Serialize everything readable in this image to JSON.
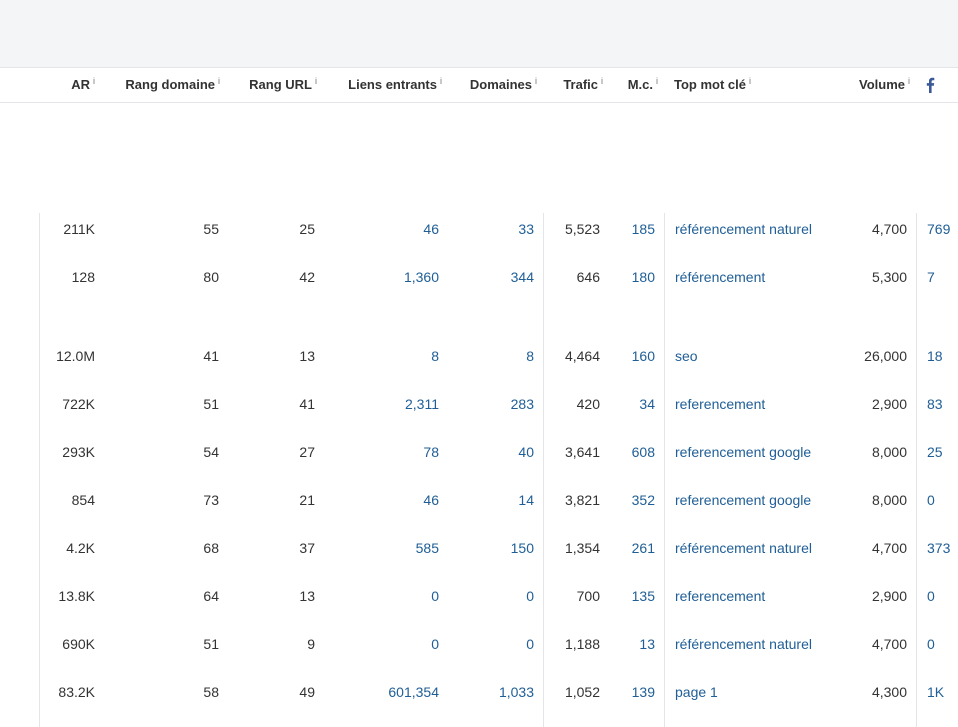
{
  "colors": {
    "text": "#333333",
    "link": "#1f5e96",
    "border": "#e3e5e8",
    "topbar": "#f4f5f7"
  },
  "info_glyph": "i",
  "header": {
    "ar": "AR",
    "rang_domaine": "Rang domaine",
    "rang_url": "Rang URL",
    "liens_entrants": "Liens entrants",
    "domaines": "Domaines",
    "trafic": "Trafic",
    "mc": "M.c.",
    "top_mot_cle": "Top mot clé",
    "volume": "Volume",
    "facebook_icon": "facebook-icon"
  },
  "rows": [
    {
      "ar": "211K",
      "rd": "55",
      "ru": "25",
      "le": "46",
      "dom": "33",
      "tr": "5,523",
      "mc": "185",
      "kw": "référencement naturel",
      "vol": "4,700",
      "fb": "769"
    },
    {
      "ar": "128",
      "rd": "80",
      "ru": "42",
      "le": "1,360",
      "dom": "344",
      "tr": "646",
      "mc": "180",
      "kw": "référencement",
      "vol": "5,300",
      "fb": "7"
    },
    {
      "ar": "12.0M",
      "rd": "41",
      "ru": "13",
      "le": "8",
      "dom": "8",
      "tr": "4,464",
      "mc": "160",
      "kw": "seo",
      "vol": "26,000",
      "fb": "18"
    },
    {
      "ar": "722K",
      "rd": "51",
      "ru": "41",
      "le": "2,311",
      "dom": "283",
      "tr": "420",
      "mc": "34",
      "kw": "referencement",
      "vol": "2,900",
      "fb": "83"
    },
    {
      "ar": "293K",
      "rd": "54",
      "ru": "27",
      "le": "78",
      "dom": "40",
      "tr": "3,641",
      "mc": "608",
      "kw": "referencement google",
      "vol": "8,000",
      "fb": "25"
    },
    {
      "ar": "854",
      "rd": "73",
      "ru": "21",
      "le": "46",
      "dom": "14",
      "tr": "3,821",
      "mc": "352",
      "kw": "referencement google",
      "vol": "8,000",
      "fb": "0"
    },
    {
      "ar": "4.2K",
      "rd": "68",
      "ru": "37",
      "le": "585",
      "dom": "150",
      "tr": "1,354",
      "mc": "261",
      "kw": "référencement naturel",
      "vol": "4,700",
      "fb": "373"
    },
    {
      "ar": "13.8K",
      "rd": "64",
      "ru": "13",
      "le": "0",
      "dom": "0",
      "tr": "700",
      "mc": "135",
      "kw": "referencement",
      "vol": "2,900",
      "fb": "0"
    },
    {
      "ar": "690K",
      "rd": "51",
      "ru": "9",
      "le": "0",
      "dom": "0",
      "tr": "1,188",
      "mc": "13",
      "kw": "référencement naturel",
      "vol": "4,700",
      "fb": "0"
    },
    {
      "ar": "83.2K",
      "rd": "58",
      "ru": "49",
      "le": "601,354",
      "dom": "1,033",
      "tr": "1,052",
      "mc": "139",
      "kw": "page 1",
      "vol": "4,300",
      "fb": "1K"
    }
  ]
}
